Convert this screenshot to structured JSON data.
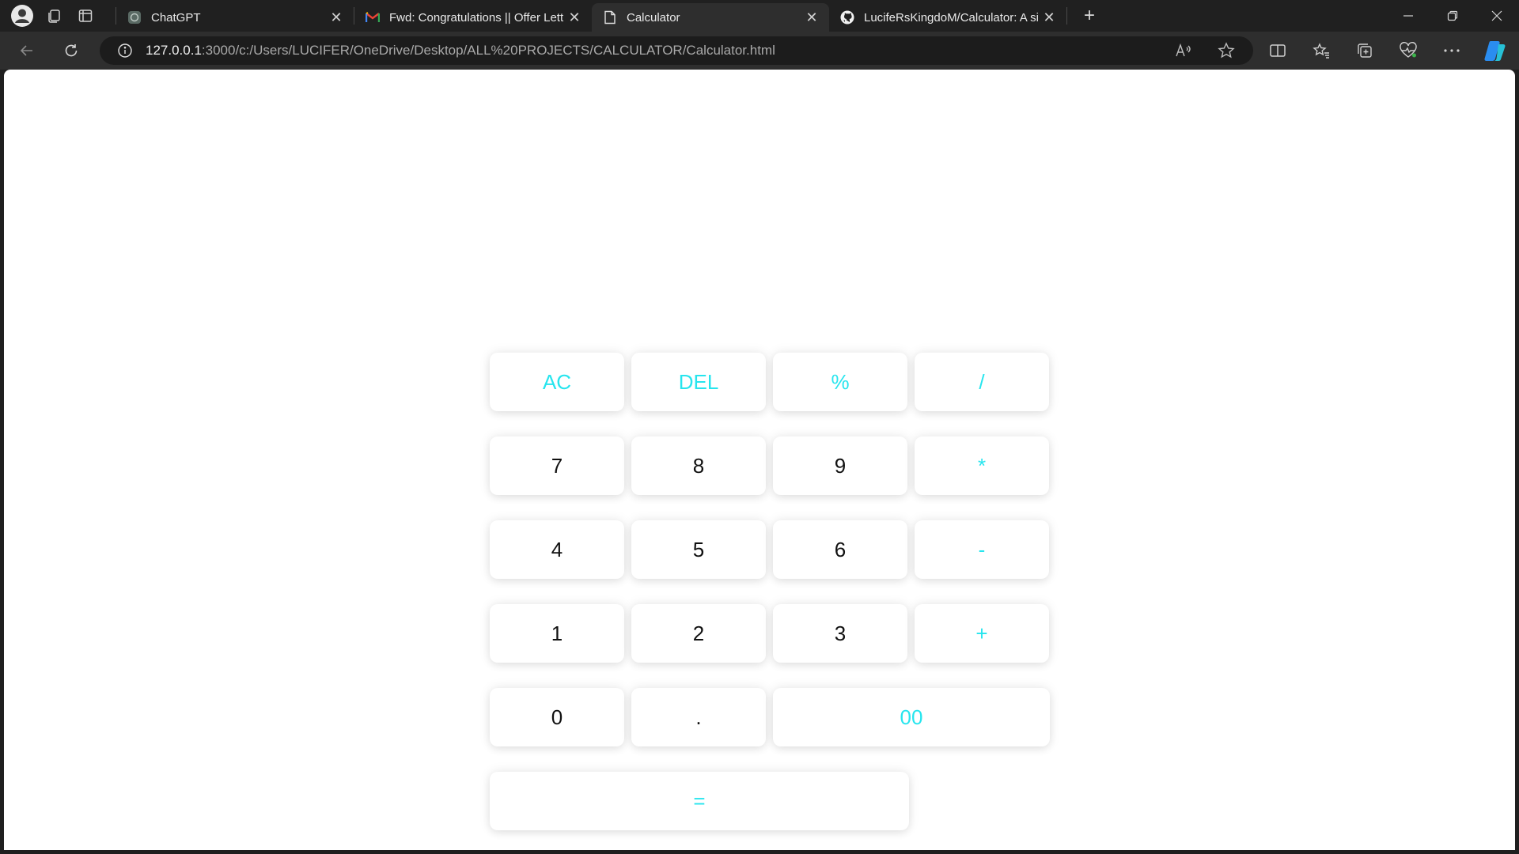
{
  "browser": {
    "tabs": [
      {
        "title": "ChatGPT",
        "favicon": "chatgpt-icon",
        "active": false
      },
      {
        "title": "Fwd: Congratulations || Offer Lett",
        "favicon": "gmail-icon",
        "active": false
      },
      {
        "title": "Calculator",
        "favicon": "page-icon",
        "active": true
      },
      {
        "title": "LucifeRsKingdoM/Calculator: A si",
        "favicon": "github-icon",
        "active": false
      }
    ],
    "address": {
      "host": "127.0.0.1",
      "rest": ":3000/c:/Users/LUCIFER/OneDrive/Desktop/ALL%20PROJECTS/CALCULATOR/Calculator.html"
    }
  },
  "calculator": {
    "keys": {
      "ac": "AC",
      "del": "DEL",
      "percent": "%",
      "divide": "/",
      "seven": "7",
      "eight": "8",
      "nine": "9",
      "multiply": "*",
      "four": "4",
      "five": "5",
      "six": "6",
      "minus": "-",
      "one": "1",
      "two": "2",
      "three": "3",
      "plus": "+",
      "zero": "0",
      "dot": ".",
      "double_zero": "00",
      "equals": "="
    },
    "accent_color": "#27e5ee",
    "digit_color": "#111111"
  }
}
